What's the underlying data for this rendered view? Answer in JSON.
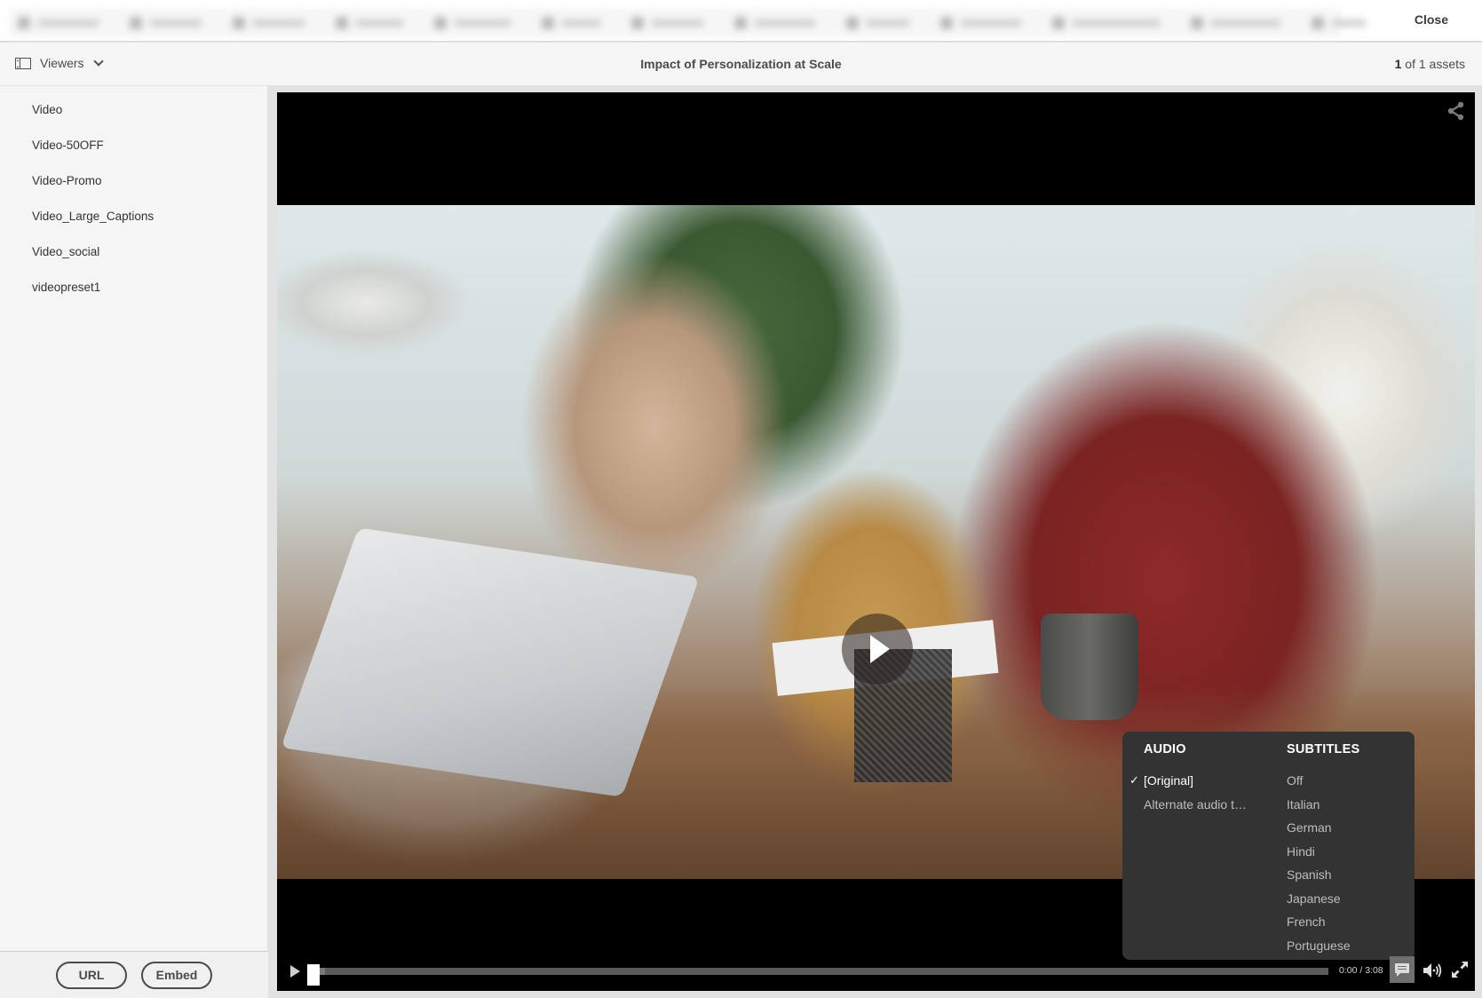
{
  "toolbar": {
    "blurred_items": 14,
    "close_label": "Close"
  },
  "header": {
    "viewers_label": "Viewers",
    "title": "Impact of Personalization at Scale",
    "asset_index": "1",
    "asset_count_text": " of 1 assets"
  },
  "sidebar": {
    "presets": [
      {
        "label": "Video"
      },
      {
        "label": "Video-50OFF"
      },
      {
        "label": "Video-Promo"
      },
      {
        "label": "Video_Large_Captions"
      },
      {
        "label": "Video_social"
      },
      {
        "label": "videopreset1"
      }
    ],
    "url_button": "URL",
    "embed_button": "Embed"
  },
  "player": {
    "share_icon": "share-icon",
    "big_play_icon": "play-icon",
    "menu": {
      "audio_heading": "AUDIO",
      "audio_options": [
        {
          "label": "[Original]",
          "selected": true
        },
        {
          "label": "Alternate audio t…",
          "selected": false
        }
      ],
      "check_glyph": "✓",
      "subtitles_heading": "SUBTITLES",
      "subtitle_options": [
        {
          "label": "Off",
          "selected": false
        },
        {
          "label": "Italian",
          "selected": false
        },
        {
          "label": "German",
          "selected": false
        },
        {
          "label": "Hindi",
          "selected": false
        },
        {
          "label": "Spanish",
          "selected": false
        },
        {
          "label": "Japanese",
          "selected": false
        },
        {
          "label": "French",
          "selected": false
        },
        {
          "label": "Portuguese",
          "selected": false
        }
      ]
    },
    "controls": {
      "time": "0:00 / 3:08",
      "progress_fraction": 0.0,
      "buffered_fraction": 0.015,
      "cc_active": true
    }
  },
  "colors": {
    "menu_bg": "#333333",
    "player_bg": "#000000",
    "stage_bg": "#e1e1e1",
    "sidebar_bg": "#f5f5f5"
  }
}
